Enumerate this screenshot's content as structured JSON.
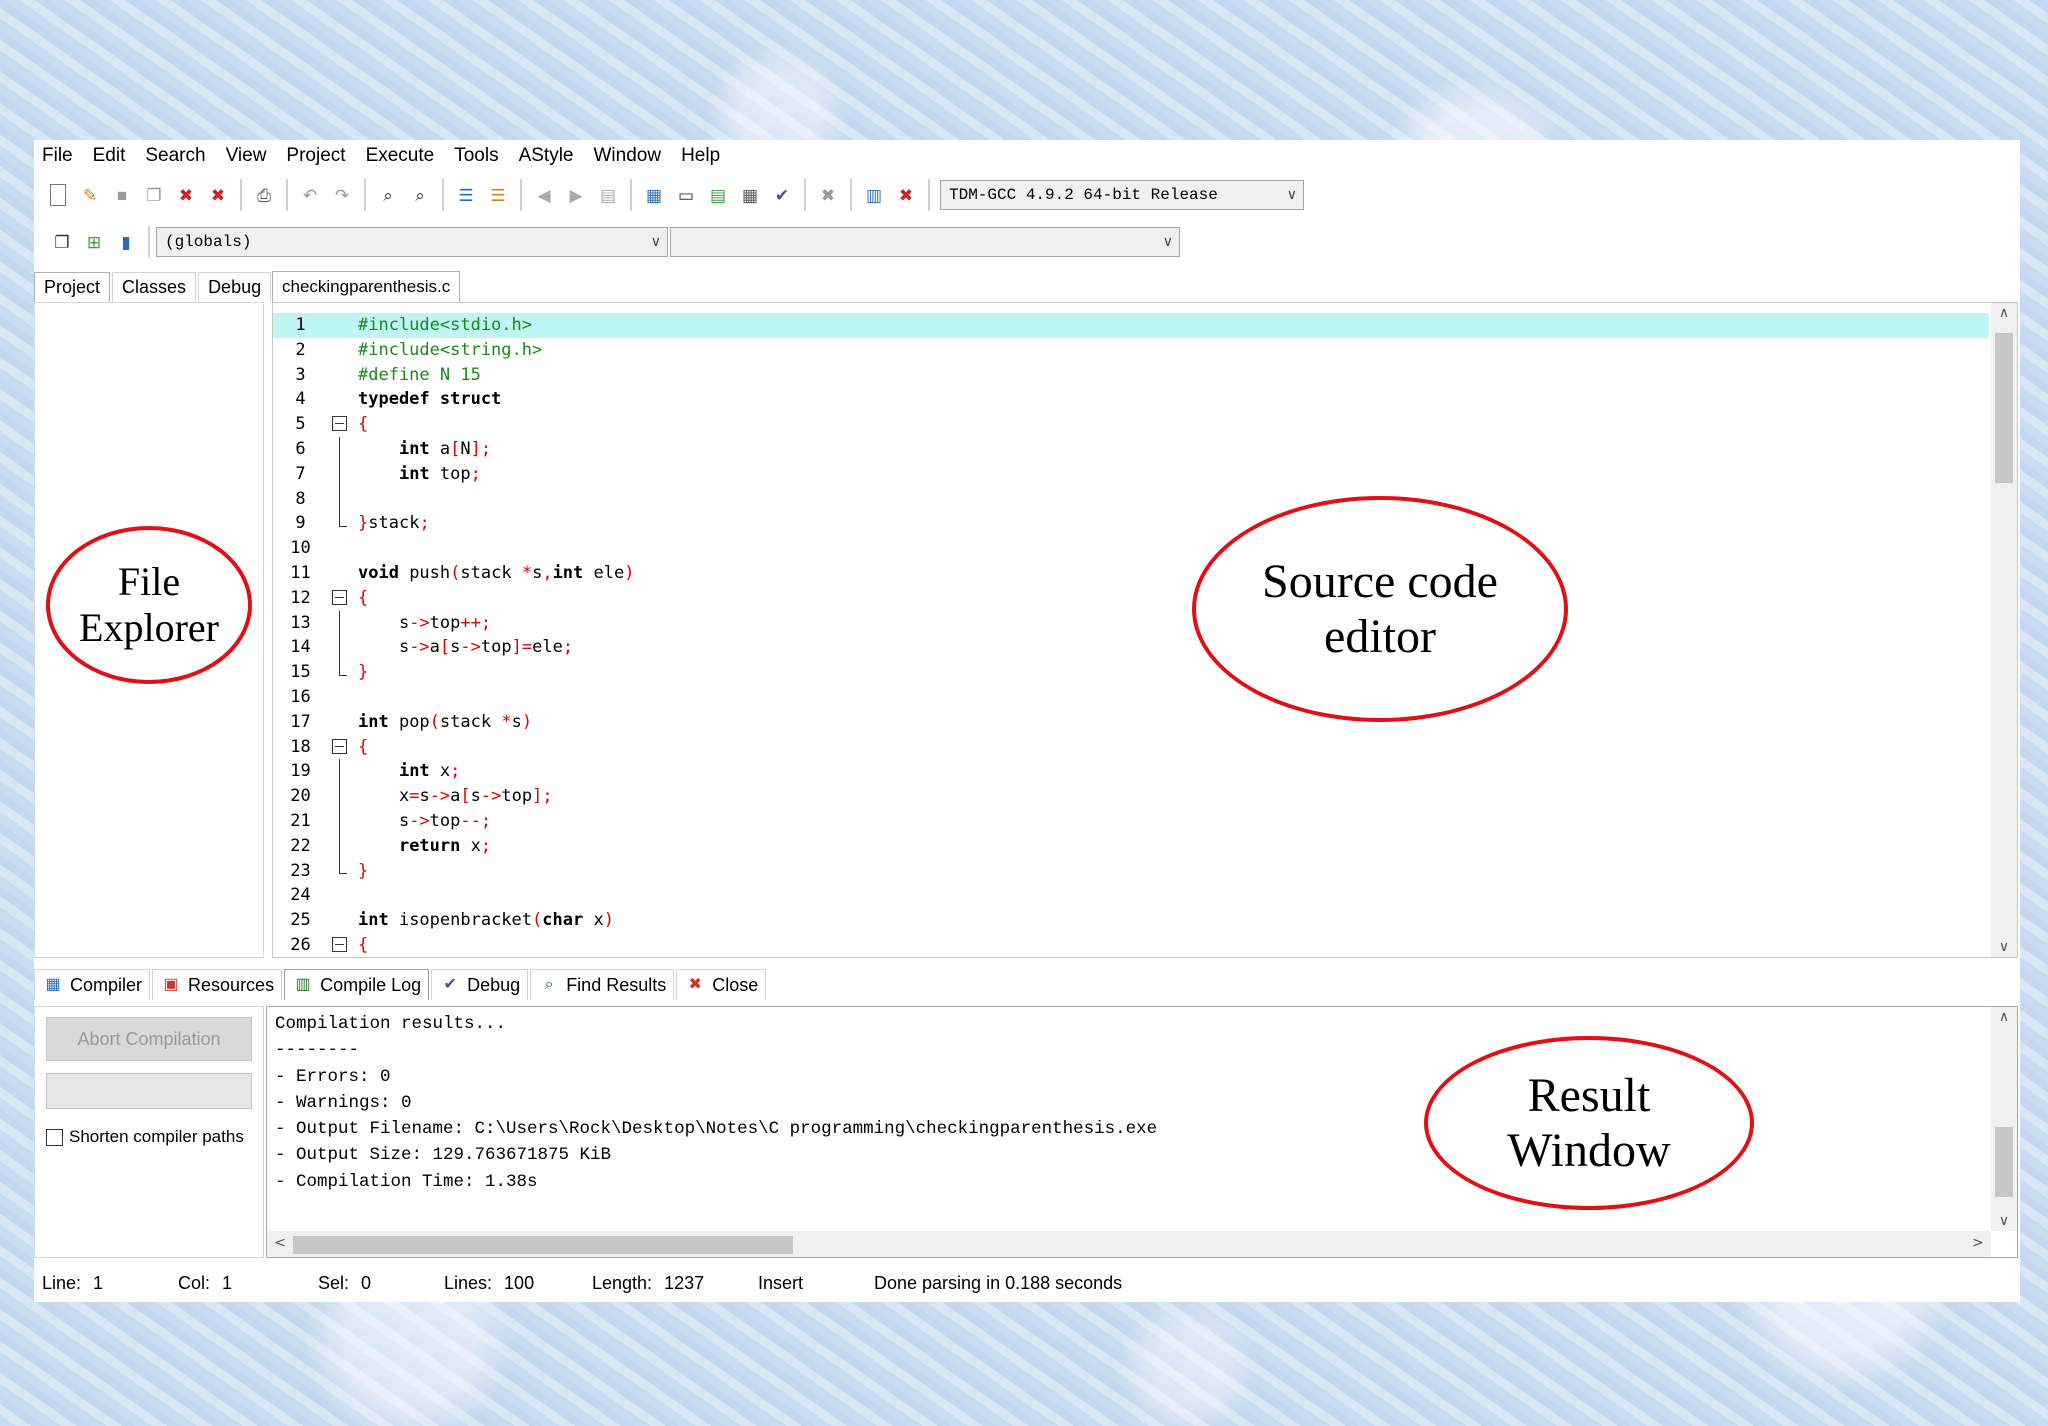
{
  "menu": [
    "File",
    "Edit",
    "Search",
    "View",
    "Project",
    "Execute",
    "Tools",
    "AStyle",
    "Window",
    "Help"
  ],
  "toolbar": {
    "compiler_select": "TDM-GCC 4.9.2 64-bit Release",
    "scope_select": "(globals)",
    "member_select": ""
  },
  "left_tabs": [
    "Project",
    "Classes",
    "Debug"
  ],
  "file_tab": "checkingparenthesis.c",
  "editor": {
    "lines": [
      {
        "n": "1",
        "t": [
          [
            "pp",
            "#include<stdio.h>"
          ]
        ],
        "current": true
      },
      {
        "n": "2",
        "t": [
          [
            "pp",
            "#include<string.h>"
          ]
        ]
      },
      {
        "n": "3",
        "t": [
          [
            "pp",
            "#define N 15"
          ]
        ]
      },
      {
        "n": "4",
        "t": [
          [
            "kw",
            "typedef struct"
          ]
        ]
      },
      {
        "n": "5",
        "t": [
          [
            "sym",
            "{"
          ]
        ],
        "fold": "open"
      },
      {
        "n": "6",
        "t": [
          [
            "tx",
            "    "
          ],
          [
            "kw",
            "int"
          ],
          [
            "tx",
            " a"
          ],
          [
            "sym",
            "["
          ],
          [
            "tx",
            "N"
          ],
          [
            "sym",
            "];"
          ]
        ],
        "fold": "bar"
      },
      {
        "n": "7",
        "t": [
          [
            "tx",
            "    "
          ],
          [
            "kw",
            "int"
          ],
          [
            "tx",
            " top"
          ],
          [
            "sym",
            ";"
          ]
        ],
        "fold": "bar"
      },
      {
        "n": "8",
        "t": [
          [
            "tx",
            ""
          ]
        ],
        "fold": "bar"
      },
      {
        "n": "9",
        "t": [
          [
            "sym",
            "}"
          ],
          [
            "tx",
            "stack"
          ],
          [
            "sym",
            ";"
          ]
        ],
        "fold": "end"
      },
      {
        "n": "10",
        "t": [
          [
            "tx",
            ""
          ]
        ]
      },
      {
        "n": "11",
        "t": [
          [
            "kw",
            "void"
          ],
          [
            "tx",
            " push"
          ],
          [
            "sym",
            "("
          ],
          [
            "tx",
            "stack "
          ],
          [
            "sym",
            "*"
          ],
          [
            "tx",
            "s"
          ],
          [
            "sym",
            ","
          ],
          [
            "kw",
            "int"
          ],
          [
            "tx",
            " ele"
          ],
          [
            "sym",
            ")"
          ]
        ]
      },
      {
        "n": "12",
        "t": [
          [
            "sym",
            "{"
          ]
        ],
        "fold": "open"
      },
      {
        "n": "13",
        "t": [
          [
            "tx",
            "    s"
          ],
          [
            "sym",
            "->"
          ],
          [
            "tx",
            "top"
          ],
          [
            "sym",
            "++;"
          ]
        ],
        "fold": "bar"
      },
      {
        "n": "14",
        "t": [
          [
            "tx",
            "    s"
          ],
          [
            "sym",
            "->"
          ],
          [
            "tx",
            "a"
          ],
          [
            "sym",
            "["
          ],
          [
            "tx",
            "s"
          ],
          [
            "sym",
            "->"
          ],
          [
            "tx",
            "top"
          ],
          [
            "sym",
            "]="
          ],
          [
            "tx",
            "ele"
          ],
          [
            "sym",
            ";"
          ]
        ],
        "fold": "bar"
      },
      {
        "n": "15",
        "t": [
          [
            "sym",
            "}"
          ]
        ],
        "fold": "end"
      },
      {
        "n": "16",
        "t": [
          [
            "tx",
            ""
          ]
        ]
      },
      {
        "n": "17",
        "t": [
          [
            "kw",
            "int"
          ],
          [
            "tx",
            " pop"
          ],
          [
            "sym",
            "("
          ],
          [
            "tx",
            "stack "
          ],
          [
            "sym",
            "*"
          ],
          [
            "tx",
            "s"
          ],
          [
            "sym",
            ")"
          ]
        ]
      },
      {
        "n": "18",
        "t": [
          [
            "sym",
            "{"
          ]
        ],
        "fold": "open"
      },
      {
        "n": "19",
        "t": [
          [
            "tx",
            "    "
          ],
          [
            "kw",
            "int"
          ],
          [
            "tx",
            " x"
          ],
          [
            "sym",
            ";"
          ]
        ],
        "fold": "bar"
      },
      {
        "n": "20",
        "t": [
          [
            "tx",
            "    x"
          ],
          [
            "sym",
            "="
          ],
          [
            "tx",
            "s"
          ],
          [
            "sym",
            "->"
          ],
          [
            "tx",
            "a"
          ],
          [
            "sym",
            "["
          ],
          [
            "tx",
            "s"
          ],
          [
            "sym",
            "->"
          ],
          [
            "tx",
            "top"
          ],
          [
            "sym",
            "];"
          ]
        ],
        "fold": "bar"
      },
      {
        "n": "21",
        "t": [
          [
            "tx",
            "    s"
          ],
          [
            "sym",
            "->"
          ],
          [
            "tx",
            "top"
          ],
          [
            "sym",
            "--;"
          ]
        ],
        "fold": "bar"
      },
      {
        "n": "22",
        "t": [
          [
            "tx",
            "    "
          ],
          [
            "kw",
            "return"
          ],
          [
            "tx",
            " x"
          ],
          [
            "sym",
            ";"
          ]
        ],
        "fold": "bar"
      },
      {
        "n": "23",
        "t": [
          [
            "sym",
            "}"
          ]
        ],
        "fold": "end"
      },
      {
        "n": "24",
        "t": [
          [
            "tx",
            ""
          ]
        ]
      },
      {
        "n": "25",
        "t": [
          [
            "kw",
            "int"
          ],
          [
            "tx",
            " isopenbracket"
          ],
          [
            "sym",
            "("
          ],
          [
            "kw",
            "char"
          ],
          [
            "tx",
            " x"
          ],
          [
            "sym",
            ")"
          ]
        ]
      },
      {
        "n": "26",
        "t": [
          [
            "sym",
            "{"
          ]
        ],
        "fold": "open"
      }
    ]
  },
  "bottom_tabs": [
    {
      "label": "Compiler",
      "icon": "compiler-grid-icon",
      "glyph": "▦",
      "color": "#2a6db5"
    },
    {
      "label": "Resources",
      "icon": "resources-icon",
      "glyph": "▣",
      "color": "#c0392b"
    },
    {
      "label": "Compile Log",
      "icon": "compile-log-chart-icon",
      "glyph": "▥",
      "color": "#2a7a2a"
    },
    {
      "label": "Debug",
      "icon": "debug-check-icon",
      "glyph": "✔",
      "color": "#5a3fb0"
    },
    {
      "label": "Find Results",
      "icon": "find-results-icon",
      "glyph": "⌕",
      "color": "#1f4f9a"
    },
    {
      "label": "Close",
      "icon": "close-sheet-icon",
      "glyph": "✖",
      "color": "#c0392b"
    }
  ],
  "compile_panel": {
    "abort_label": "Abort Compilation",
    "shorten_label": "Shorten compiler paths"
  },
  "result_lines": [
    "Compilation results...",
    "--------",
    "- Errors: 0",
    "- Warnings: 0",
    "- Output Filename: C:\\Users\\Rock\\Desktop\\Notes\\C programming\\checkingparenthesis.exe",
    "- Output Size: 129.763671875 KiB",
    "- Compilation Time: 1.38s"
  ],
  "status": {
    "line_label": "Line:",
    "line_value": "1",
    "col_label": "Col:",
    "col_value": "1",
    "sel_label": "Sel:",
    "sel_value": "0",
    "lines_label": "Lines:",
    "lines_value": "100",
    "length_label": "Length:",
    "length_value": "1237",
    "mode": "Insert",
    "message": "Done parsing in 0.188 seconds"
  },
  "annotations": {
    "file_explorer": [
      "File",
      "Explorer"
    ],
    "source_editor": [
      "Source code",
      "editor"
    ],
    "result_window": [
      "Result",
      "Window"
    ]
  },
  "colors": {
    "annotation_red": "#e10f16",
    "current_line": "#bff6f3",
    "preprocessor": "#1a8a1a",
    "symbol": "#e00000"
  }
}
